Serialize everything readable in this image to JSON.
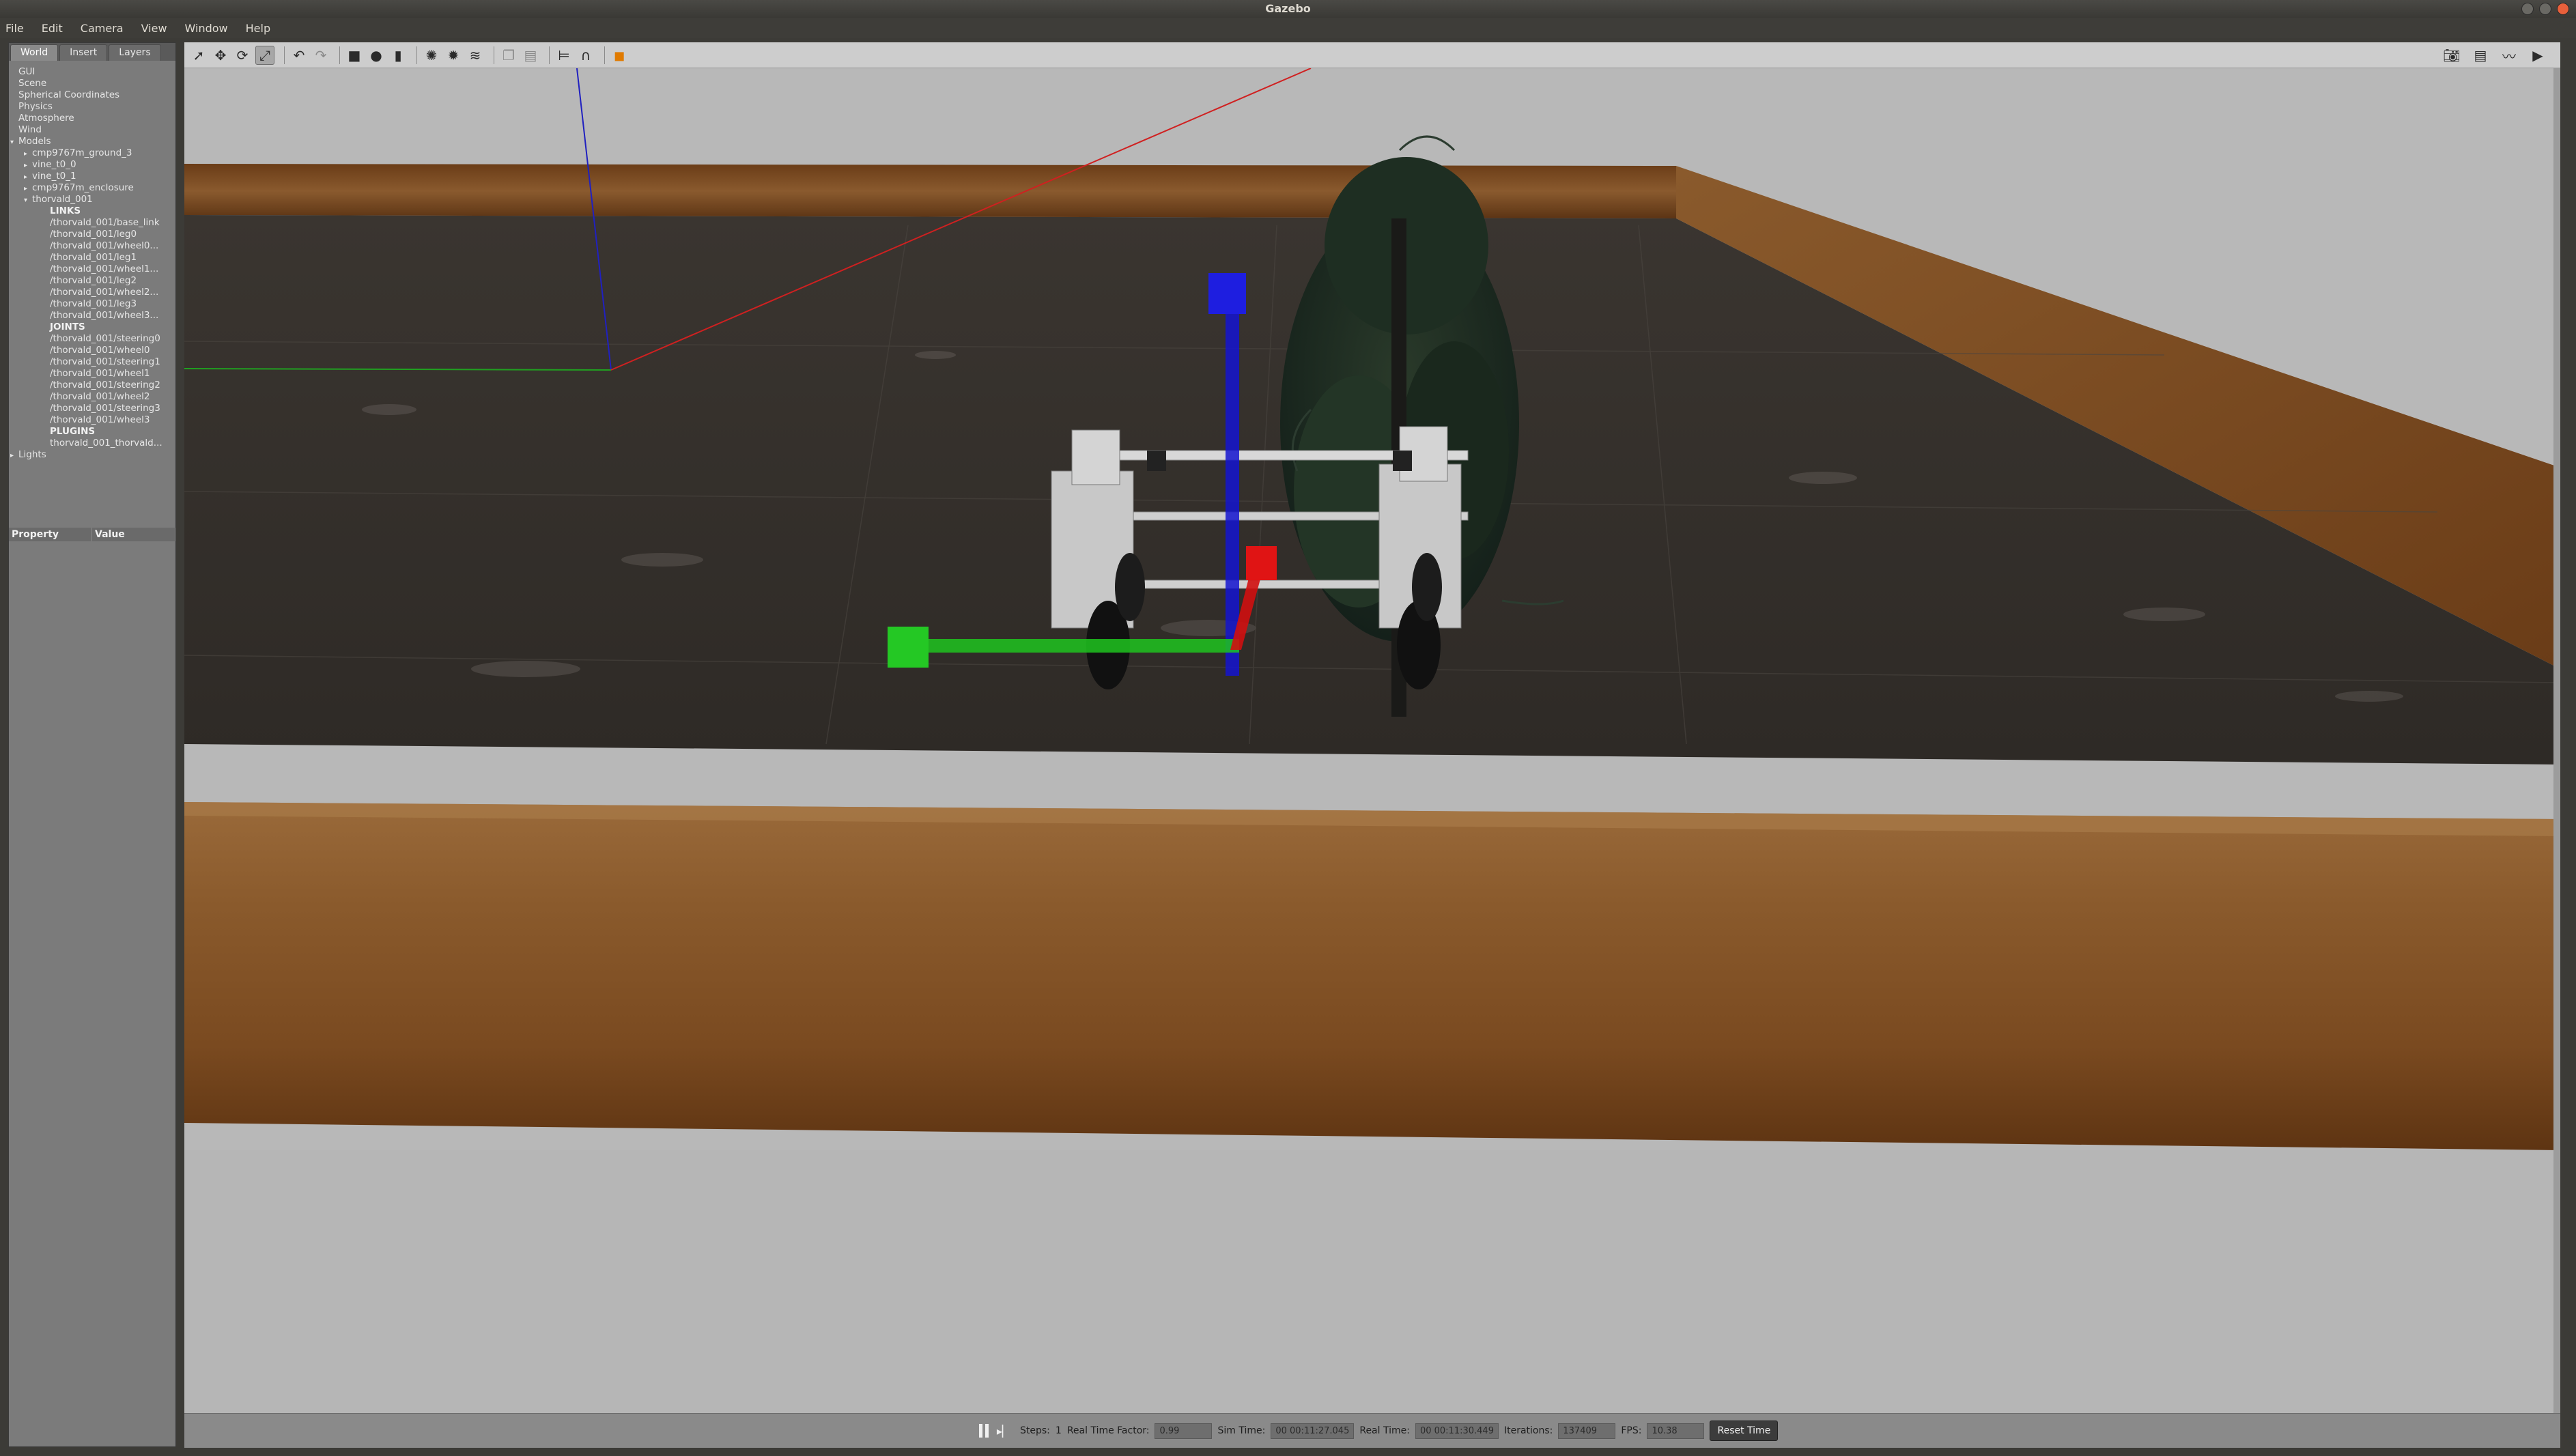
{
  "window": {
    "title": "Gazebo"
  },
  "menu": [
    "File",
    "Edit",
    "Camera",
    "View",
    "Window",
    "Help"
  ],
  "left_panel": {
    "tabs": [
      "World",
      "Insert",
      "Layers"
    ],
    "active_tab": "World",
    "tree": [
      {
        "label": "GUI",
        "indent": 0,
        "arrow": ""
      },
      {
        "label": "Scene",
        "indent": 0,
        "arrow": ""
      },
      {
        "label": "Spherical Coordinates",
        "indent": 0,
        "arrow": ""
      },
      {
        "label": "Physics",
        "indent": 0,
        "arrow": ""
      },
      {
        "label": "Atmosphere",
        "indent": 0,
        "arrow": ""
      },
      {
        "label": "Wind",
        "indent": 0,
        "arrow": ""
      },
      {
        "label": "Models",
        "indent": 0,
        "arrow": "▾"
      },
      {
        "label": "cmp9767m_ground_3",
        "indent": 1,
        "arrow": "▸"
      },
      {
        "label": "vine_t0_0",
        "indent": 1,
        "arrow": "▸"
      },
      {
        "label": "vine_t0_1",
        "indent": 1,
        "arrow": "▸"
      },
      {
        "label": "cmp9767m_enclosure",
        "indent": 1,
        "arrow": "▸"
      },
      {
        "label": "thorvald_001",
        "indent": 1,
        "arrow": "▾"
      },
      {
        "label": "LINKS",
        "indent": 2,
        "arrow": "",
        "section": true
      },
      {
        "label": "/thorvald_001/base_link",
        "indent": 2,
        "arrow": ""
      },
      {
        "label": "/thorvald_001/leg0",
        "indent": 2,
        "arrow": ""
      },
      {
        "label": "/thorvald_001/wheel0...",
        "indent": 2,
        "arrow": ""
      },
      {
        "label": "/thorvald_001/leg1",
        "indent": 2,
        "arrow": ""
      },
      {
        "label": "/thorvald_001/wheel1...",
        "indent": 2,
        "arrow": ""
      },
      {
        "label": "/thorvald_001/leg2",
        "indent": 2,
        "arrow": ""
      },
      {
        "label": "/thorvald_001/wheel2...",
        "indent": 2,
        "arrow": ""
      },
      {
        "label": "/thorvald_001/leg3",
        "indent": 2,
        "arrow": ""
      },
      {
        "label": "/thorvald_001/wheel3...",
        "indent": 2,
        "arrow": ""
      },
      {
        "label": "JOINTS",
        "indent": 2,
        "arrow": "",
        "section": true
      },
      {
        "label": "/thorvald_001/steering0",
        "indent": 2,
        "arrow": ""
      },
      {
        "label": "/thorvald_001/wheel0",
        "indent": 2,
        "arrow": ""
      },
      {
        "label": "/thorvald_001/steering1",
        "indent": 2,
        "arrow": ""
      },
      {
        "label": "/thorvald_001/wheel1",
        "indent": 2,
        "arrow": ""
      },
      {
        "label": "/thorvald_001/steering2",
        "indent": 2,
        "arrow": ""
      },
      {
        "label": "/thorvald_001/wheel2",
        "indent": 2,
        "arrow": ""
      },
      {
        "label": "/thorvald_001/steering3",
        "indent": 2,
        "arrow": ""
      },
      {
        "label": "/thorvald_001/wheel3",
        "indent": 2,
        "arrow": ""
      },
      {
        "label": "PLUGINS",
        "indent": 2,
        "arrow": "",
        "section": true
      },
      {
        "label": "thorvald_001_thorvald...",
        "indent": 2,
        "arrow": ""
      },
      {
        "label": "Lights",
        "indent": 0,
        "arrow": "▸"
      }
    ],
    "property_header": {
      "property": "Property",
      "value": "Value"
    }
  },
  "bottom_bar": {
    "steps_label": "Steps:",
    "steps_value": "1",
    "rtf_label": "Real Time Factor:",
    "rtf_value": "0.99",
    "sim_time_label": "Sim Time:",
    "sim_time_value": "00 00:11:27.045",
    "real_time_label": "Real Time:",
    "real_time_value": "00 00:11:30.449",
    "iterations_label": "Iterations:",
    "iterations_value": "137409",
    "fps_label": "FPS:",
    "fps_value": "10.38",
    "reset_label": "Reset Time"
  },
  "colors": {
    "axis_x": "#e01010",
    "axis_y": "#1ec41e",
    "axis_z": "#1414d0",
    "floor": "#3a342e",
    "wood": "#7a4a20"
  }
}
